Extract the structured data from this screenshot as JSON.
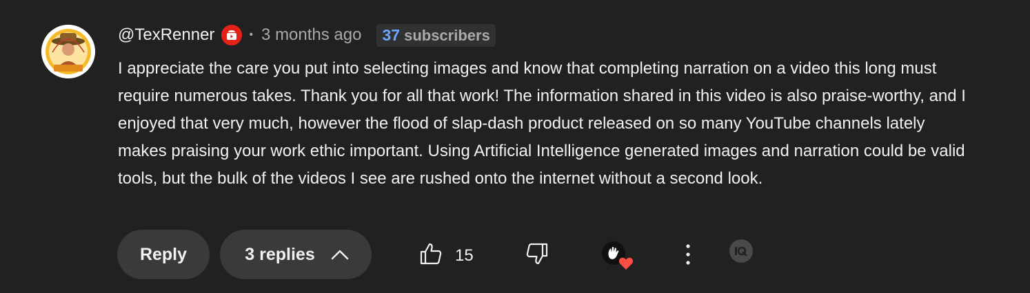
{
  "comment": {
    "author": "@TexRenner",
    "badge_icon": "youtube-creator-badge-icon",
    "separator": "•",
    "time": "3 months ago",
    "subscribers": {
      "count": "37",
      "label": "subscribers"
    },
    "text": "I appreciate the care you put into selecting images and know that completing narration on a video this long must require numerous takes. Thank you for all that work! The information shared in this video is also praise-worthy, and I enjoyed that very much, however the flood of slap-dash product released on so many YouTube channels lately makes praising your work ethic important. Using Artificial Intelligence generated images and narration could be valid tools, but the bulk of the videos I see are rushed onto the internet without a second look."
  },
  "actions": {
    "reply_label": "Reply",
    "replies_label": "3 replies",
    "like_count": "15",
    "like_icon": "thumbs-up-icon",
    "dislike_icon": "thumbs-down-icon",
    "more_icon": "more-vertical-icon",
    "hearted_icon": "creator-heart-icon",
    "extension_icon": "extension-icon"
  },
  "colors": {
    "background": "#212121",
    "text": "#f1f1f1",
    "secondary_text": "#aaaaaa",
    "subscriber_accent": "#6ea6ff",
    "badge_red": "#e62117",
    "heart_red": "#ff4e45",
    "pill_bg": "#3a3a3a"
  }
}
